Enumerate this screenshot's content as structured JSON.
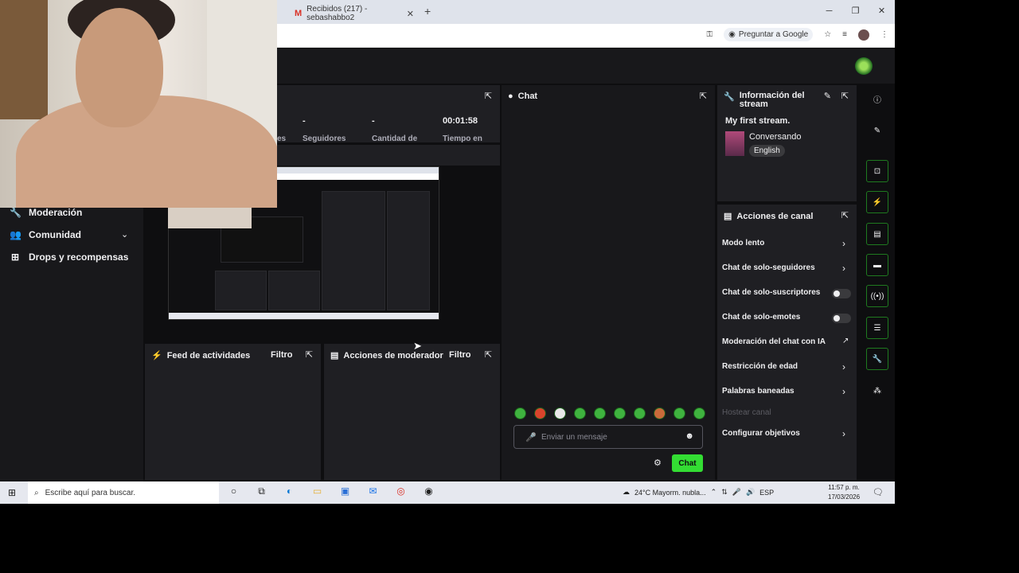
{
  "browser": {
    "tab_title": "Recibidos (217) - sebashabbo2",
    "new_tab": "+",
    "ask_google": "Preguntar a Google",
    "win_min": "─",
    "win_max": "❐",
    "win_close": "✕",
    "tab_close": "✕"
  },
  "sidebar": {
    "items": [
      {
        "label": "Moderación",
        "icon": "wrench-icon"
      },
      {
        "label": "Comunidad",
        "icon": "people-icon"
      },
      {
        "label": "Drops y recompensas",
        "icon": "gift-icon"
      }
    ]
  },
  "stats": {
    "items": [
      {
        "value": "-",
        "label": "Seguidores"
      },
      {
        "value": "-",
        "label": "Cantidad de"
      },
      {
        "value": "00:01:58",
        "label": "Tiempo en"
      }
    ],
    "partial_label": "es"
  },
  "activity_feed": {
    "title": "Feed de actividades",
    "filter": "Filtro"
  },
  "mod_actions": {
    "title": "Acciones de moderador",
    "filter": "Filtro"
  },
  "chat": {
    "title": "Chat",
    "placeholder": "Enviar un mensaje",
    "send_label": "Chat"
  },
  "stream_info": {
    "title_line1": "Información del",
    "title_line2": "stream",
    "stream_title": "My first stream.",
    "category": "Conversando",
    "language": "English"
  },
  "channel_actions": {
    "title": "Acciones de canal",
    "items": [
      {
        "label": "Modo lento",
        "control": "chevron"
      },
      {
        "label": "Chat de solo-seguidores",
        "control": "chevron"
      },
      {
        "label": "Chat de solo-suscriptores",
        "control": "toggle"
      },
      {
        "label": "Chat de solo-emotes",
        "control": "toggle"
      },
      {
        "label": "Moderación del chat con IA",
        "control": "external"
      },
      {
        "label": "Restricción de edad",
        "control": "chevron"
      },
      {
        "label": "Palabras baneadas",
        "control": "chevron"
      },
      {
        "label": "Hostear canal",
        "control": "none"
      },
      {
        "label": "Configurar objetivos",
        "control": "chevron"
      }
    ]
  },
  "taskbar": {
    "search_placeholder": "Escribe aquí para buscar.",
    "weather": "24°C  Mayorm. nubla...",
    "lang": "ESP",
    "time": "11:57 p. m.",
    "date": "17/03/2026"
  },
  "colors": {
    "accent": "#33dd33",
    "bg": "#0e0e10",
    "panel": "#1f1f23"
  }
}
